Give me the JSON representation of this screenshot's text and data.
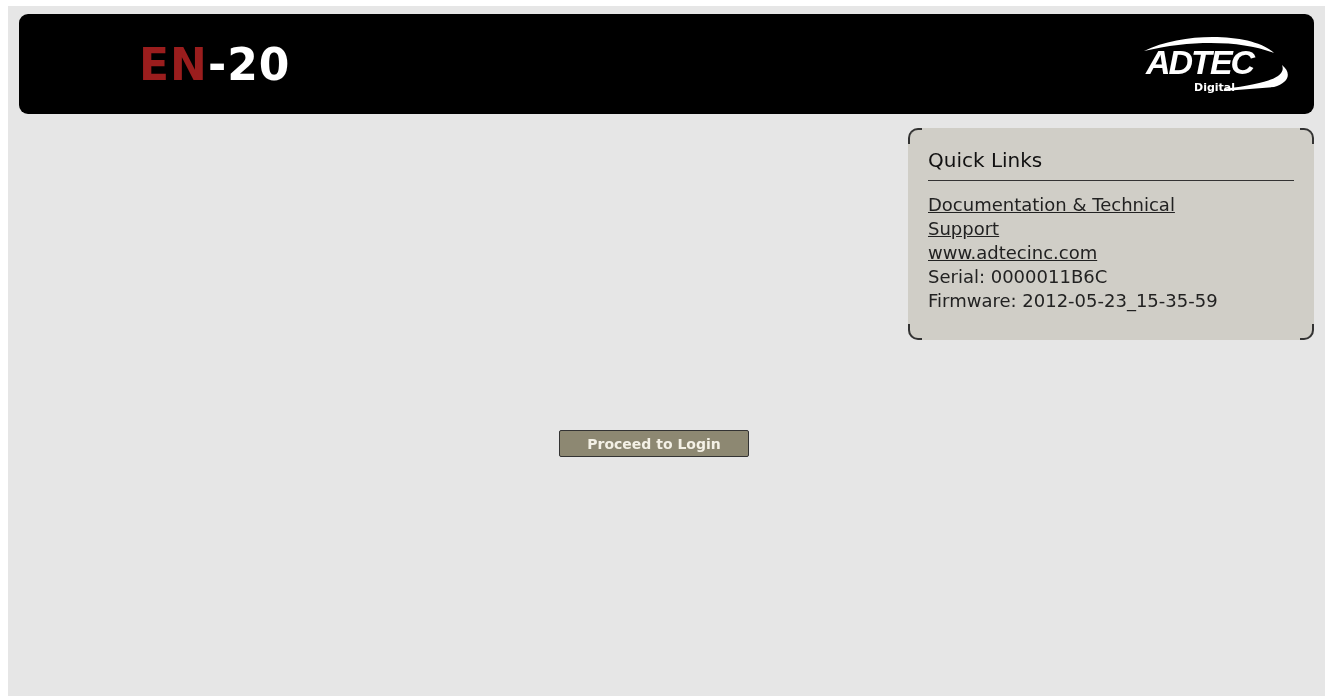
{
  "header": {
    "product": {
      "prefix": "EN",
      "suffix": "-20"
    },
    "logo": {
      "name": "ADTEC",
      "tagline": "Digital"
    }
  },
  "quick_links": {
    "title": "Quick Links",
    "items": [
      {
        "kind": "link",
        "text": "Documentation & Technical Support"
      },
      {
        "kind": "link",
        "text": "www.adtecinc.com"
      },
      {
        "kind": "text",
        "text": "Serial: 0000011B6C"
      },
      {
        "kind": "text",
        "text": "Firmware: 2012-05-23_15-35-59"
      }
    ]
  },
  "login_button": {
    "label": "Proceed to Login"
  }
}
